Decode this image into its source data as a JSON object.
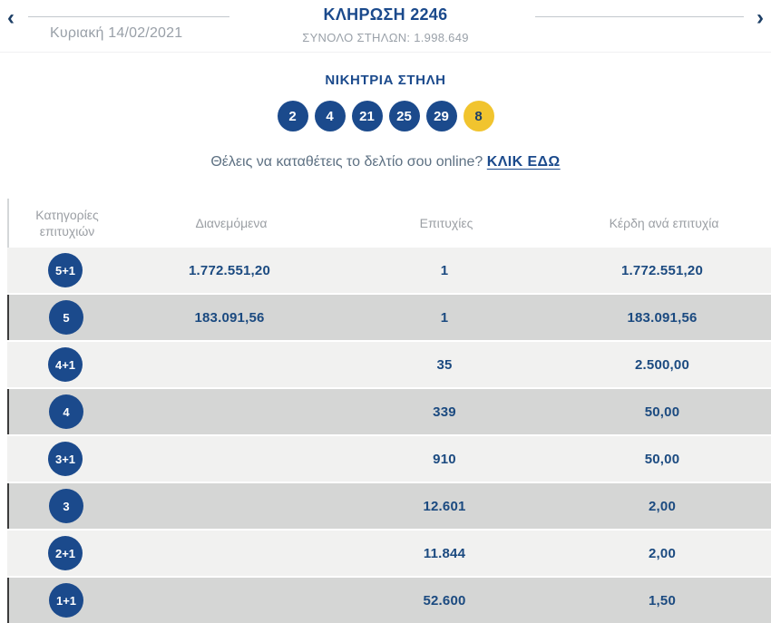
{
  "header": {
    "prev_arrow": "‹",
    "next_arrow": "›",
    "date": "Κυριακή 14/02/2021",
    "title": "ΚΛΗΡΩΣΗ 2246",
    "total_columns": "ΣΥΝΟΛΟ ΣΤΗΛΩΝ: 1.998.649"
  },
  "winning": {
    "heading": "ΝΙΚΗΤΡΙΑ ΣΤΗΛΗ",
    "numbers": [
      "2",
      "4",
      "21",
      "25",
      "29"
    ],
    "joker": "8"
  },
  "promo": {
    "text": "Θέλεις να καταθέτεις το δελτίο σου online?",
    "link_label": "ΚΛΙΚ ΕΔΩ"
  },
  "table": {
    "headers": [
      "Κατηγορίες επιτυχιών",
      "Διανεμόμενα",
      "Επιτυχίες",
      "Κέρδη ανά επιτυχία"
    ],
    "rows": [
      {
        "category": "5+1",
        "distributed": "1.772.551,20",
        "winners": "1",
        "prize": "1.772.551,20"
      },
      {
        "category": "5",
        "distributed": "183.091,56",
        "winners": "1",
        "prize": "183.091,56"
      },
      {
        "category": "4+1",
        "distributed": "",
        "winners": "35",
        "prize": "2.500,00"
      },
      {
        "category": "4",
        "distributed": "",
        "winners": "339",
        "prize": "50,00"
      },
      {
        "category": "3+1",
        "distributed": "",
        "winners": "910",
        "prize": "50,00"
      },
      {
        "category": "3",
        "distributed": "",
        "winners": "12.601",
        "prize": "2,00"
      },
      {
        "category": "2+1",
        "distributed": "",
        "winners": "11.844",
        "prize": "2,00"
      },
      {
        "category": "1+1",
        "distributed": "",
        "winners": "52.600",
        "prize": "1,50"
      }
    ]
  },
  "colors": {
    "navy": "#1b4a8c",
    "joker_yellow": "#f1c42e",
    "muted_gray": "#9aa0a6",
    "row_light": "#f1f1f0",
    "row_dark": "#d5d6d5"
  }
}
